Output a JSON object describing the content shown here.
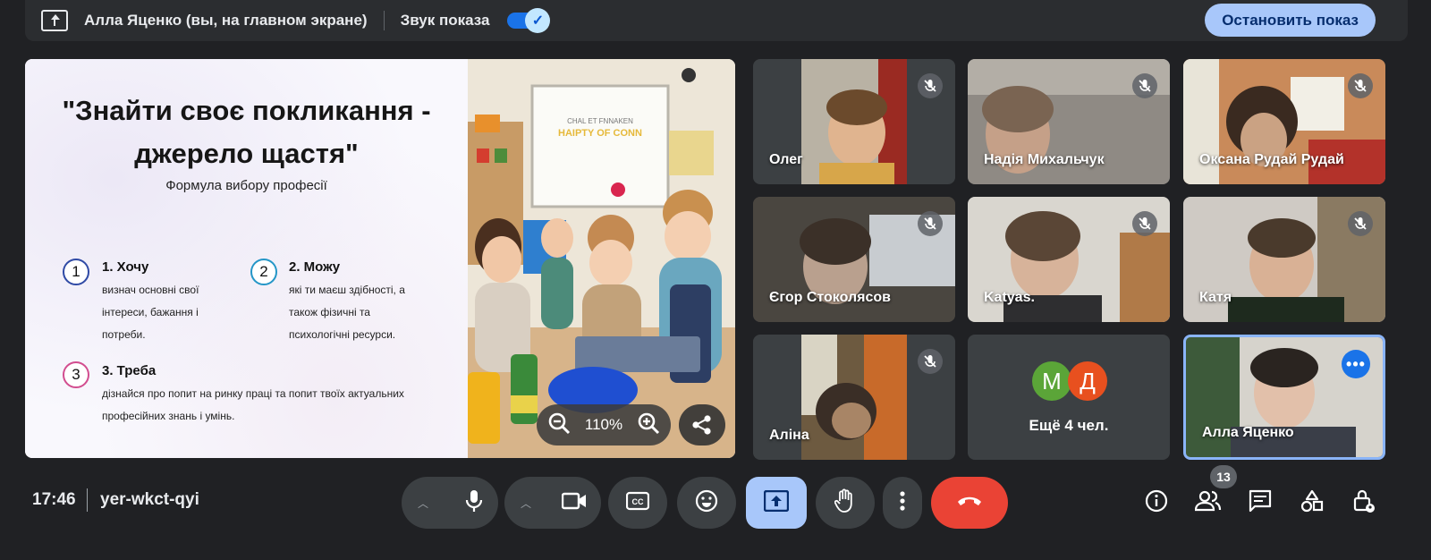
{
  "topbar": {
    "presenter": "Алла Яценко (вы, на главном экране)",
    "sound_label": "Звук показа",
    "sound_on": true,
    "stop_label": "Остановить показ"
  },
  "slide": {
    "title_line1": "\"Знайти своє покликання -",
    "title_line2": "джерело щастя\"",
    "subtitle": "Формула вибору професії",
    "items": [
      {
        "num": "1",
        "head": "1. Хочу",
        "lines": [
          "визнач основні свої",
          "інтереси, бажання і",
          "потреби."
        ]
      },
      {
        "num": "2",
        "head": "2. Можу",
        "lines": [
          "які ти маєш здібності, а",
          "також фізичні та",
          "психологічні ресурси."
        ]
      },
      {
        "num": "3",
        "head": "3. Треба",
        "lines": [
          "дізнайся про попит на ринку праці та попит твоїх актуальних",
          "професійних знань і умінь."
        ]
      }
    ],
    "poster_text_1": "CHAL ET FNNAKEN",
    "poster_text_2": "HAIPTY OF CONN",
    "zoom_level": "110%"
  },
  "participants": [
    {
      "name": "Олег",
      "muted": true
    },
    {
      "name": "Надія Михальчук",
      "muted": true
    },
    {
      "name": "Оксана Рудай Рудай",
      "muted": true
    },
    {
      "name": "Єгор Стоколясов",
      "muted": true
    },
    {
      "name": "Katyas.",
      "muted": true
    },
    {
      "name": "Катя",
      "muted": true
    },
    {
      "name": "Аліна",
      "muted": true
    },
    {
      "name": "Алла Яценко",
      "muted": false
    }
  ],
  "more_tile": {
    "avatars": [
      {
        "letter": "М",
        "color": "#5ba538"
      },
      {
        "letter": "Д",
        "color": "#e8501f"
      }
    ],
    "label": "Ещё 4 чел."
  },
  "bottombar": {
    "time": "17:46",
    "meeting_code": "yer-wkct-qyi",
    "participant_count": "13"
  },
  "colors": {
    "background": "#202124",
    "accent": "#a8c7fa",
    "end_call": "#ea4335",
    "active_border": "#8ab4f8"
  }
}
